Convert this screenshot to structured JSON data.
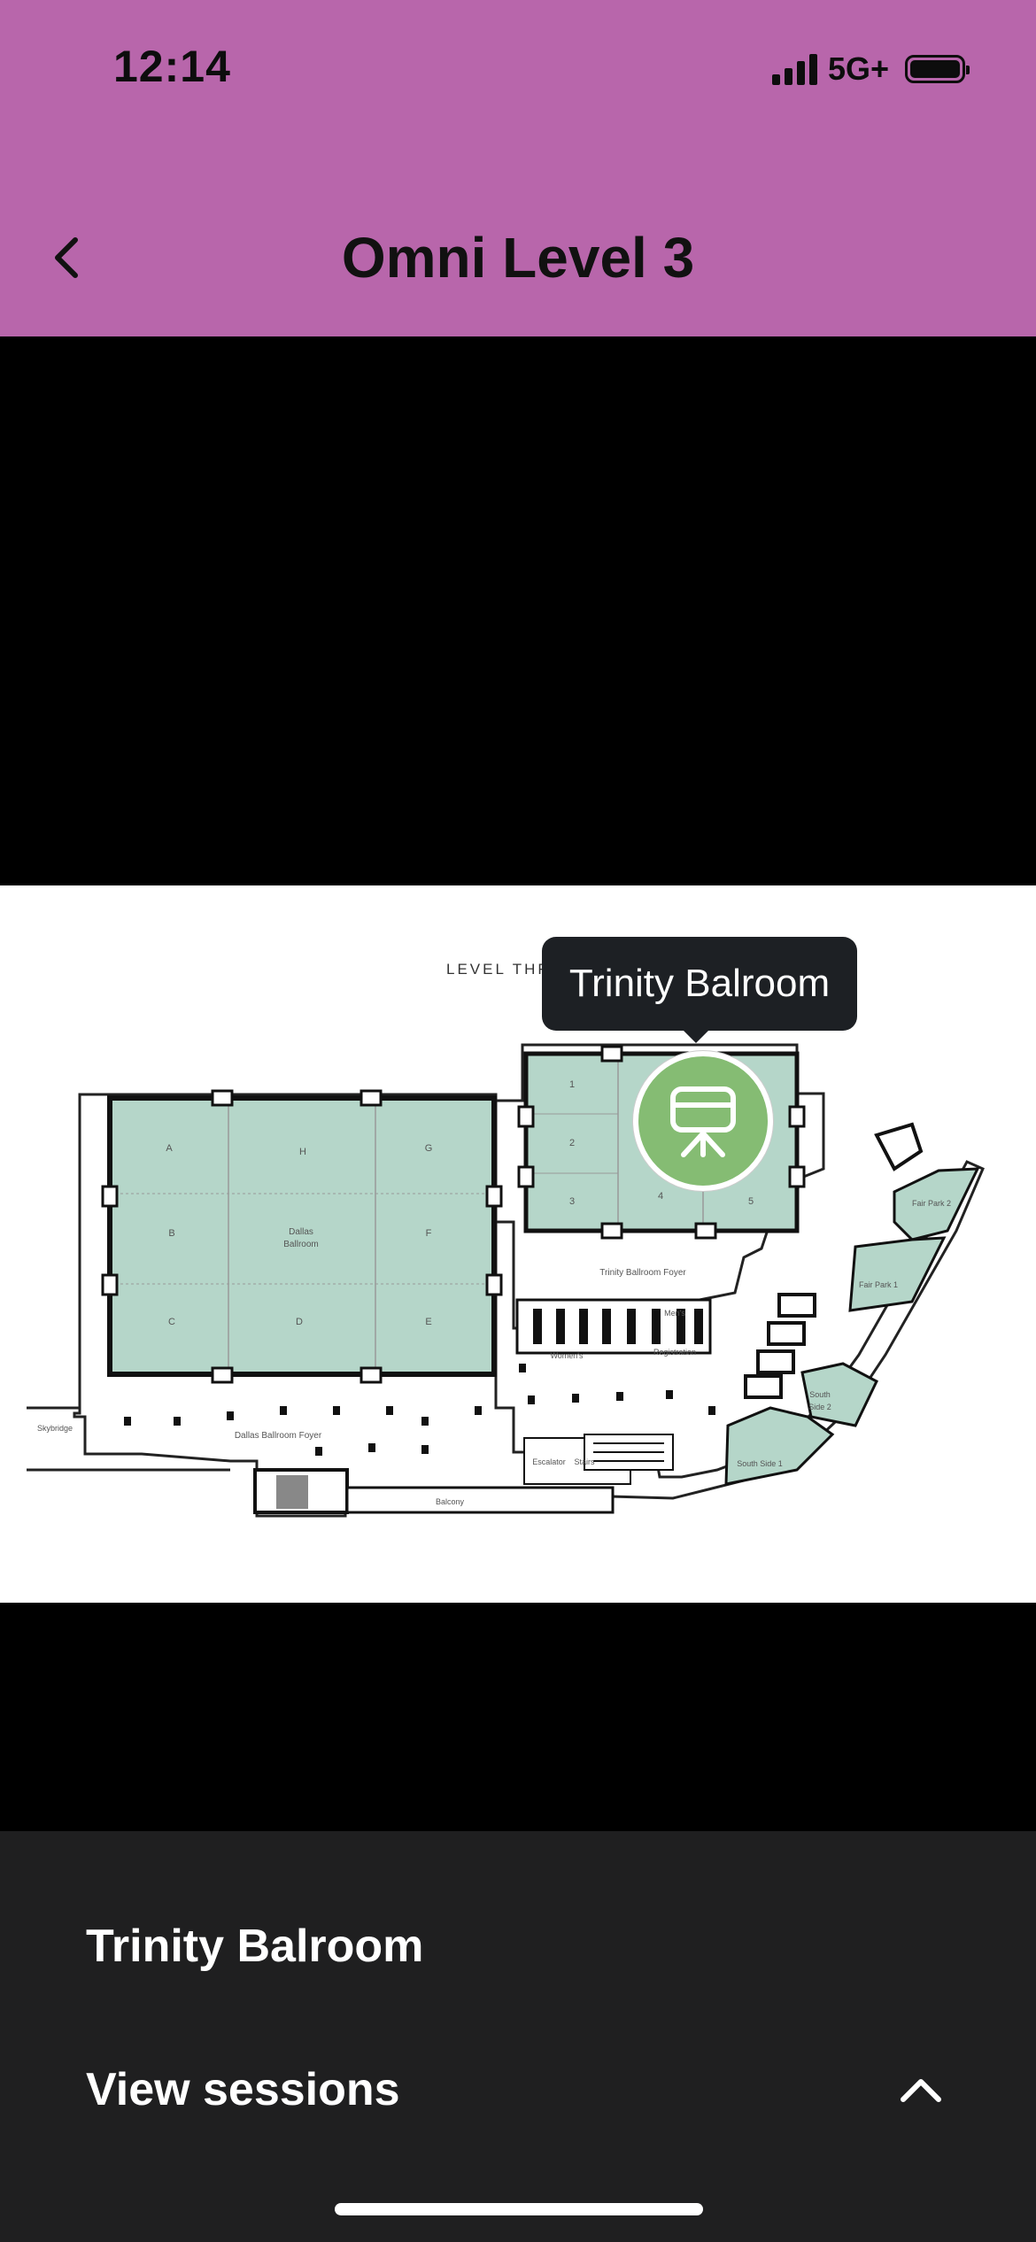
{
  "status": {
    "time": "12:14",
    "network": "5G+"
  },
  "nav": {
    "title": "Omni Level 3"
  },
  "map": {
    "level_label": "LEVEL THR",
    "tooltip": "Trinity Balroom",
    "pin_icon": "presentation-board-icon",
    "rooms": {
      "dallas_a": "A",
      "dallas_h": "H",
      "dallas_g": "G",
      "dallas_b": "B",
      "dallas_f": "F",
      "dallas_c": "C",
      "dallas_d": "D",
      "dallas_e": "E",
      "dallas_name_1": "Dallas",
      "dallas_name_2": "Ballroom",
      "trinity_1": "1",
      "trinity_2": "2",
      "trinity_3": "3",
      "trinity_4": "4",
      "trinity_5": "5",
      "trinity_foyer": "Trinity Ballroom Foyer",
      "mens": "Men's",
      "womens": "Women's",
      "registration": "Registration",
      "dallas_foyer": "Dallas Ballroom Foyer",
      "skybridge": "Skybridge",
      "escalator": "Escalator",
      "stairs": "Stairs",
      "balcony": "Balcony",
      "fair_park_2": "Fair Park 2",
      "fair_park_1": "Fair Park 1",
      "south_side_2a": "South",
      "south_side_2b": "Side 2",
      "south_side_1": "South Side 1"
    },
    "room_fill": "#b5d6c9",
    "pin_color": "#85bc73"
  },
  "sheet": {
    "title": "Trinity Balroom",
    "view_sessions": "View sessions"
  },
  "colors": {
    "header": "#b866ab",
    "sheet_bg": "#1f1f20"
  }
}
